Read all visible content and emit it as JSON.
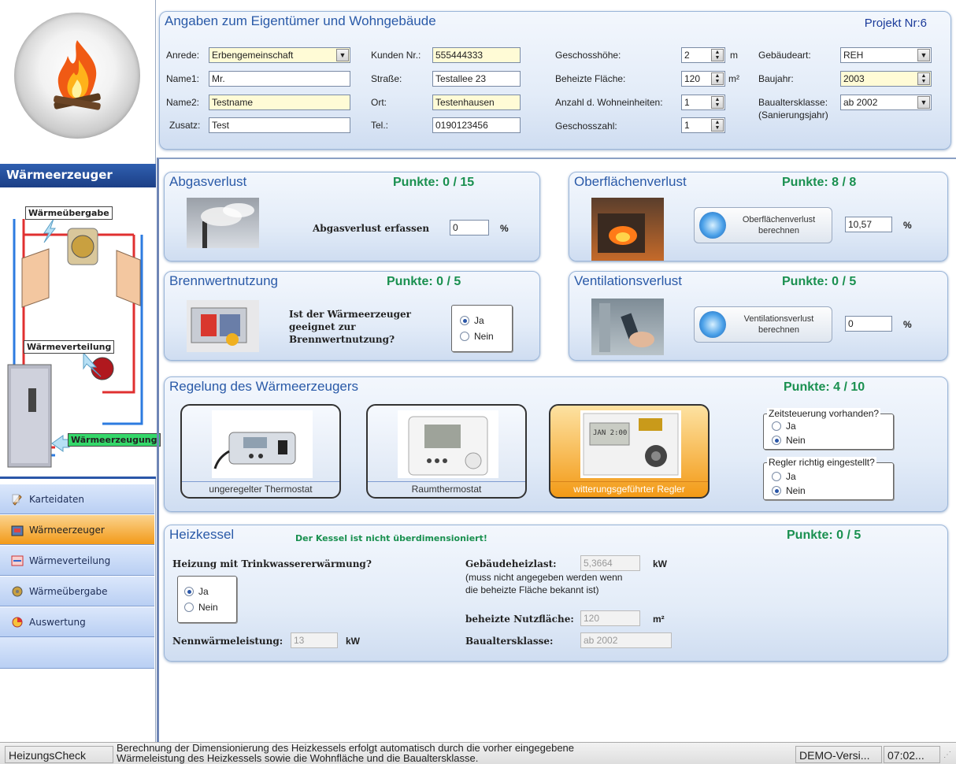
{
  "owner_panel": {
    "title": "Angaben zum Eigentümer und Wohngebäude",
    "project_label": "Projekt Nr:6",
    "anrede": {
      "label": "Anrede:",
      "value": "Erbengemeinschaft"
    },
    "name1": {
      "label": "Name1:",
      "value": "Mr."
    },
    "name2": {
      "label": "Name2:",
      "value": "Testname"
    },
    "zusatz": {
      "label": "Zusatz:",
      "value": "Test"
    },
    "kunden_nr": {
      "label": "Kunden Nr.:",
      "value": "555444333"
    },
    "strasse": {
      "label": "Straße:",
      "value": "Testallee 23"
    },
    "ort": {
      "label": "Ort:",
      "value": "Testenhausen"
    },
    "tel": {
      "label": "Tel.:",
      "value": "0190123456"
    },
    "geschosshoehe": {
      "label": "Geschosshöhe:",
      "value": "2",
      "unit": "m"
    },
    "beheizte_flaeche": {
      "label": "Beheizte Fläche:",
      "value": "120",
      "unit": "m²"
    },
    "wohneinheiten": {
      "label": "Anzahl d. Wohneinheiten:",
      "value": "1"
    },
    "geschosszahl": {
      "label": "Geschosszahl:",
      "value": "1"
    },
    "gebaeudeart": {
      "label": "Gebäudeart:",
      "value": "REH"
    },
    "baujahr": {
      "label": "Baujahr:",
      "value": "2003"
    },
    "baualtersklasse": {
      "label": "Baualtersklasse:",
      "sublabel": "(Sanierungsjahr)",
      "value": "ab 2002"
    }
  },
  "sidebar": {
    "header": "Wärmeerzeuger",
    "diagram_labels": {
      "uebergabe": "Wärmeübergabe",
      "verteilung": "Wärmeverteilung",
      "erzeugung": "Wärmeerzeugung"
    },
    "items": [
      {
        "label": "Karteidaten",
        "icon": "pencil-icon"
      },
      {
        "label": "Wärmeerzeuger",
        "icon": "boiler-icon",
        "active": true
      },
      {
        "label": "Wärmeverteilung",
        "icon": "pipes-icon"
      },
      {
        "label": "Wärmeübergabe",
        "icon": "radiator-icon"
      },
      {
        "label": "Auswertung",
        "icon": "chart-icon"
      }
    ]
  },
  "abgas": {
    "title": "Abgasverlust",
    "points": "Punkte: 0 / 15",
    "field_label": "Abgasverlust erfassen",
    "value": "0",
    "unit": "%"
  },
  "oberflaeche": {
    "title": "Oberflächenverlust",
    "points": "Punkte: 8 / 8",
    "button_line1": "Oberflächenverlust",
    "button_line2": "berechnen",
    "value": "10,57",
    "unit": "%"
  },
  "brennwert": {
    "title": "Brennwertnutzung",
    "points": "Punkte: 0 / 5",
    "question_line1": "Ist der Wärmeerzeuger",
    "question_line2": "geeignet zur",
    "question_line3": "Brennwertnutzung?",
    "yes": "Ja",
    "no": "Nein"
  },
  "ventilation": {
    "title": "Ventilationsverlust",
    "points": "Punkte: 0 / 5",
    "button_line1": "Ventilationsverlust",
    "button_line2": "berechnen",
    "value": "0",
    "unit": "%"
  },
  "regelung": {
    "title": "Regelung des Wärmeerzeugers",
    "points": "Punkte: 4 / 10",
    "tiles": [
      "ungeregelter Thermostat",
      "Raumthermostat",
      "witterungsgeführter Regler"
    ],
    "zeit_title": "Zeitsteuerung vorhanden?",
    "regler_title": "Regler richtig eingestellt?",
    "yes": "Ja",
    "no": "Nein",
    "display_text": "JAN 2:00"
  },
  "heizkessel": {
    "title": "Heizkessel",
    "message": "Der Kessel ist nicht überdimensioniert!",
    "points": "Punkte: 0 / 5",
    "trinkwasser_label": "Heizung mit Trinkwassererwärmung?",
    "yes": "Ja",
    "no": "Nein",
    "nenn_label": "Nennwärmeleistung:",
    "nenn_value": "13",
    "nenn_unit": "kW",
    "heizlast_label": "Gebäudeheizlast:",
    "heizlast_value": "5,3664",
    "heizlast_unit": "kW",
    "heizlast_note1": "(muss nicht angegeben werden wenn",
    "heizlast_note2": "die beheizte Fläche bekannt ist)",
    "nutzflaeche_label": "beheizte Nutzfläche:",
    "nutzflaeche_value": "120",
    "nutzflaeche_unit": "m²",
    "bak_label": "Baualtersklasse:",
    "bak_value": "ab 2002"
  },
  "status": {
    "app": "HeizungsCheck",
    "line1": "Berechnung der Dimensionierung des Heizkessels erfolgt automatisch durch die vorher eingegebene",
    "line2": "Wärmeleistung des Heizkessels sowie die Wohnfläche und die Baualtersklasse.",
    "demo": "DEMO-Versi...",
    "time": "07:02..."
  }
}
